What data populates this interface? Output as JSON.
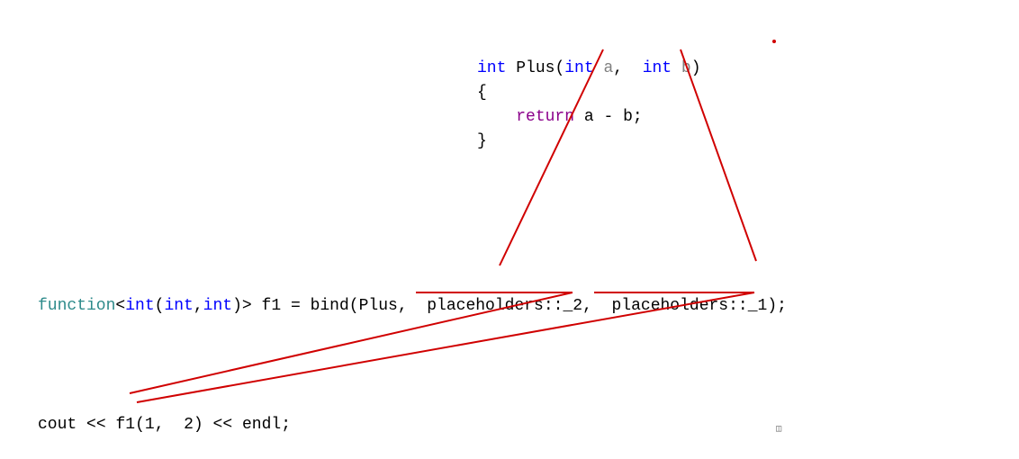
{
  "funcdef": {
    "int1": "int",
    "name": "Plus",
    "lparen": "(",
    "int2": "int",
    "a": "a",
    "comma": ",",
    "int3": "int",
    "b": "b",
    "rparen": ")",
    "lbrace": "{",
    "return_kw": "return",
    "expr_a": "a",
    "minus": "-",
    "expr_b": "b",
    "semicolon": ";",
    "rbrace": "}"
  },
  "bindline": {
    "function_kw": "function",
    "lt": "<",
    "int1": "int",
    "lparen1": "(",
    "int2": "int",
    "comma1": ",",
    "int3": "int",
    "rparen1": ")",
    "gt": ">",
    "var": "f1",
    "eq": "=",
    "bind_kw": "bind",
    "lparen2": "(",
    "plus": "Plus",
    "comma2": ",",
    "ph2": "placeholders::_2",
    "comma3": ",",
    "ph1": "placeholders::_1",
    "rparen2": ")",
    "semicolon": ";"
  },
  "callline": {
    "cout": "cout",
    "lshift1": "<<",
    "f1": "f1",
    "lparen": "(",
    "one": "1",
    "comma": ",",
    "two": "2",
    "rparen": ")",
    "lshift2": "<<",
    "endl": "endl",
    "semicolon": ";"
  },
  "annotations": {
    "lines": [
      {
        "from": "param-a",
        "to": "ph2"
      },
      {
        "from": "param-b",
        "to": "ph1"
      },
      {
        "from": "arg-2",
        "to": "ph2"
      },
      {
        "from": "arg-1",
        "to": "ph1"
      }
    ]
  }
}
